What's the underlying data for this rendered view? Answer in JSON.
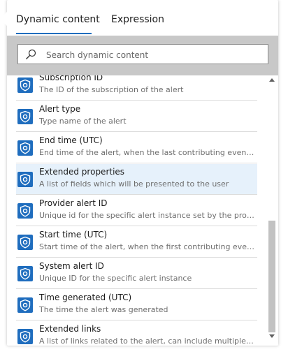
{
  "tabs": [
    {
      "label": "Dynamic content",
      "active": true
    },
    {
      "label": "Expression",
      "active": false
    }
  ],
  "search": {
    "placeholder": "Search dynamic content"
  },
  "items": [
    {
      "title": "Subscription ID",
      "description": "The ID of the subscription of the alert"
    },
    {
      "title": "Alert type",
      "description": "Type name of the alert"
    },
    {
      "title": "End time (UTC)",
      "description": "End time of the alert, when the last contributing event was..."
    },
    {
      "title": "Extended properties",
      "description": "A list of fields which will be presented to the user",
      "selected": true
    },
    {
      "title": "Provider alert ID",
      "description": "Unique id for the specific alert instance set by the provider"
    },
    {
      "title": "Start time (UTC)",
      "description": "Start time of the alert, when the first contributing event w..."
    },
    {
      "title": "System alert ID",
      "description": "Unique ID for the specific alert instance"
    },
    {
      "title": "Time generated (UTC)",
      "description": "The time the alert was generated"
    },
    {
      "title": "Extended links",
      "description": "A list of links related to the alert, can include multiple types"
    }
  ],
  "icon_name": "security-center-shield-icon",
  "colors": {
    "accent": "#1f6dbe",
    "selected_row": "#e6f1fb",
    "search_band": "#c8c8c8"
  }
}
